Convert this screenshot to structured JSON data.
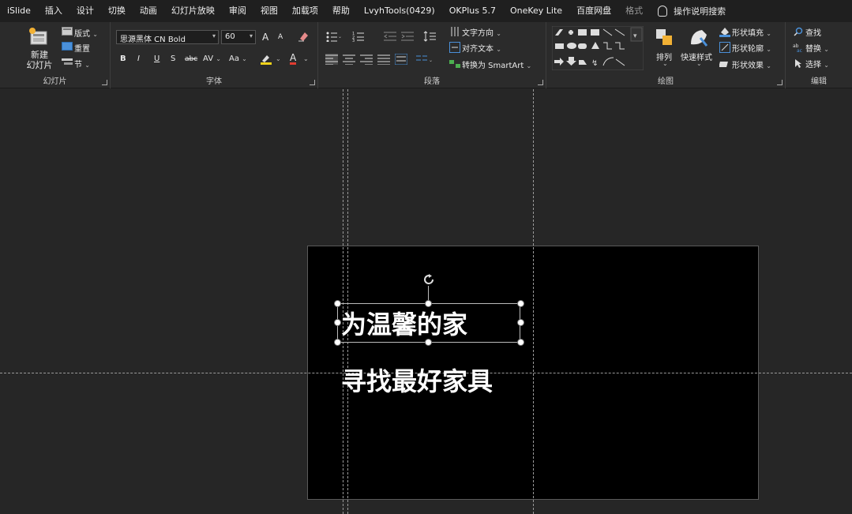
{
  "menu": {
    "tabs": [
      "iSlide",
      "插入",
      "设计",
      "切换",
      "动画",
      "幻灯片放映",
      "审阅",
      "视图",
      "加载项",
      "帮助",
      "LvyhTools(0429)",
      "OKPlus 5.7",
      "OneKey Lite",
      "百度网盘",
      "格式"
    ],
    "search_label": "操作说明搜索"
  },
  "ribbon": {
    "slides": {
      "group_label": "幻灯片",
      "new_slide": "新建\n幻灯片",
      "layout": "版式",
      "reset": "重置",
      "section": "节"
    },
    "font": {
      "group_label": "字体",
      "font_name": "思源黑体 CN Bold",
      "font_size": "60",
      "bold": "B",
      "italic": "I",
      "underline": "U",
      "shadow": "S",
      "strike": "abc",
      "spacing": "AV",
      "case": "Aa",
      "grow": "A",
      "shrink": "A",
      "color": "A"
    },
    "paragraph": {
      "group_label": "段落",
      "text_direction": "文字方向",
      "align_text": "对齐文本",
      "smartart": "转换为 SmartArt"
    },
    "drawing": {
      "group_label": "绘图",
      "arrange": "排列",
      "quick_styles": "快速样式",
      "shape_fill": "形状填充",
      "shape_outline": "形状轮廓",
      "shape_effects": "形状效果"
    },
    "editing": {
      "group_label": "编辑",
      "find": "查找",
      "replace": "替换",
      "select": "选择"
    }
  },
  "slide": {
    "line1": "为温馨的家",
    "line2": "寻找最好家具"
  }
}
